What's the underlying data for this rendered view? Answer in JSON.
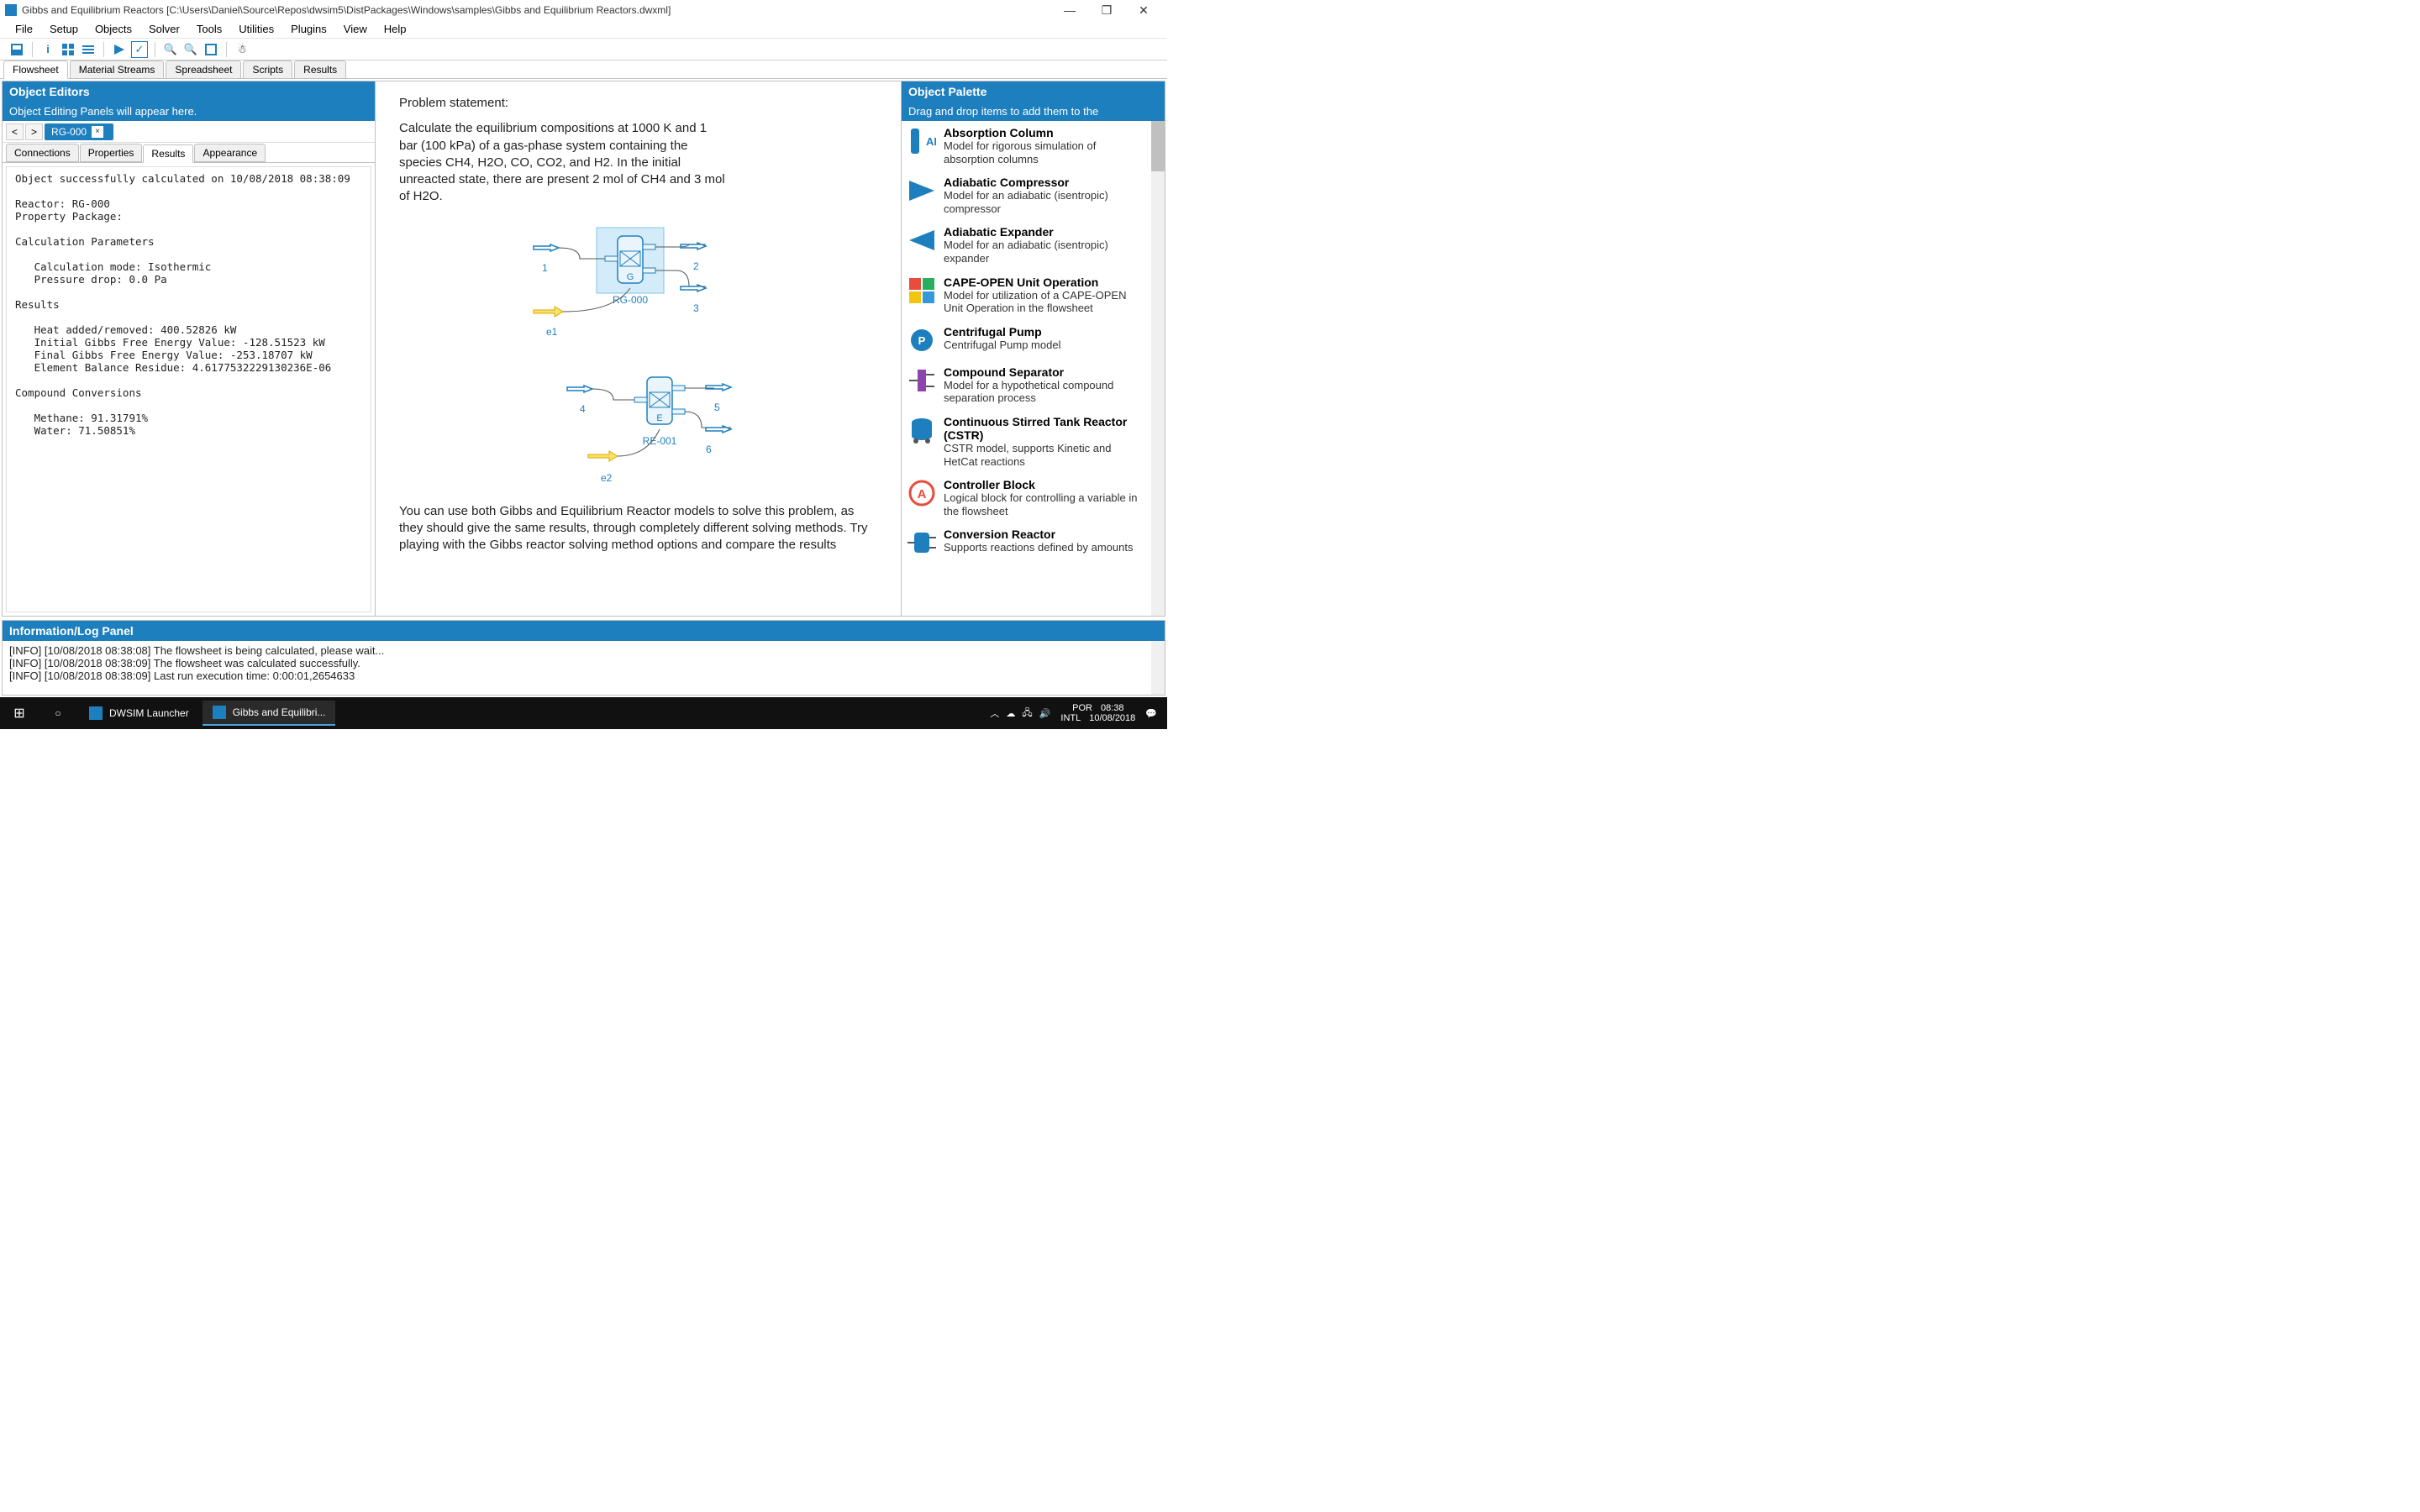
{
  "titlebar": {
    "title": "Gibbs and Equilibrium Reactors [C:\\Users\\Daniel\\Source\\Repos\\dwsim5\\DistPackages\\Windows\\samples\\Gibbs and Equilibrium Reactors.dwxml]"
  },
  "menu": {
    "items": [
      "File",
      "Setup",
      "Objects",
      "Solver",
      "Tools",
      "Utilities",
      "Plugins",
      "View",
      "Help"
    ]
  },
  "doc_tabs": {
    "items": [
      "Flowsheet",
      "Material Streams",
      "Spreadsheet",
      "Scripts",
      "Results"
    ],
    "active_index": 0
  },
  "left_panel": {
    "header": "Object Editors",
    "subheader": "Object Editing Panels will appear here.",
    "object_tab": "RG-000",
    "sub_tabs": [
      "Connections",
      "Properties",
      "Results",
      "Appearance"
    ],
    "sub_active_index": 2,
    "results_text": "Object successfully calculated on 10/08/2018 08:38:09\n\nReactor: RG-000\nProperty Package:\n\nCalculation Parameters\n\n   Calculation mode: Isothermic\n   Pressure drop: 0.0 Pa\n\nResults\n\n   Heat added/removed: 400.52826 kW\n   Initial Gibbs Free Energy Value: -128.51523 kW\n   Final Gibbs Free Energy Value: -253.18707 kW\n   Element Balance Residue: 4.6177532229130236E-06\n\nCompound Conversions\n\n   Methane: 91.31791%\n   Water: 71.50851%"
  },
  "center": {
    "problem_title": "Problem statement:",
    "problem_body": "Calculate the equilibrium compositions at 1000 K and 1 bar (100 kPa) of a gas-phase system containing the species CH4, H2O, CO, CO2, and H2. In the initial unreacted state, there are present 2 mol of CH4 and 3 mol of H2O.",
    "reactor1": {
      "name": "RG-000",
      "letter": "G",
      "stream_in": "1",
      "stream_out1": "2",
      "stream_out2": "3",
      "energy": "e1"
    },
    "reactor2": {
      "name": "RE-001",
      "letter": "E",
      "stream_in": "4",
      "stream_out1": "5",
      "stream_out2": "6",
      "energy": "e2"
    },
    "bottom_text": "You can use both Gibbs and Equilibrium Reactor models to solve this problem, as they should give the same results, through completely different solving methods. Try playing with the Gibbs reactor solving method options and compare the results"
  },
  "right_panel": {
    "header": "Object Palette",
    "subheader": "Drag and drop items to add them to the",
    "items": [
      {
        "title": "Absorption Column",
        "desc": "Model for rigorous simulation of absorption columns",
        "icon": "AB",
        "color": "#1e7fbe"
      },
      {
        "title": "Adiabatic Compressor",
        "desc": "Model for an adiabatic (isentropic) compressor",
        "icon": "tri-r",
        "color": "#1e7fbe"
      },
      {
        "title": "Adiabatic Expander",
        "desc": "Model for an adiabatic (isentropic) expander",
        "icon": "tri-l",
        "color": "#1e7fbe"
      },
      {
        "title": "CAPE-OPEN Unit Operation",
        "desc": "Model for utilization of a CAPE-OPEN Unit Operation in the flowsheet",
        "icon": "puzzle",
        "color": "#e07b00"
      },
      {
        "title": "Centrifugal Pump",
        "desc": "Centrifugal Pump model",
        "icon": "P",
        "color": "#1e7fbe"
      },
      {
        "title": "Compound Separator",
        "desc": "Model for a hypothetical compound separation process",
        "icon": "sep",
        "color": "#8e44ad"
      },
      {
        "title": "Continuous Stirred Tank Reactor (CSTR)",
        "desc": "CSTR model, supports Kinetic and HetCat reactions",
        "icon": "tank",
        "color": "#1e7fbe"
      },
      {
        "title": "Controller Block",
        "desc": "Logical block for controlling a variable in the flowsheet",
        "icon": "A",
        "color": "#e74c3c"
      },
      {
        "title": "Conversion Reactor",
        "desc": "Supports reactions defined by amounts",
        "icon": "conv",
        "color": "#1e7fbe"
      }
    ]
  },
  "log": {
    "header": "Information/Log Panel",
    "lines": [
      "[INFO] [10/08/2018 08:38:08] The flowsheet is being calculated, please wait...",
      "[INFO] [10/08/2018 08:38:09] The flowsheet was calculated successfully.",
      "[INFO] [10/08/2018 08:38:09] Last run execution time: 0:00:01,2654633"
    ]
  },
  "taskbar": {
    "tasks": [
      "DWSIM Launcher",
      "Gibbs and Equilibri..."
    ],
    "lang": "POR",
    "kbd": "INTL",
    "time": "08:38",
    "date": "10/08/2018"
  }
}
